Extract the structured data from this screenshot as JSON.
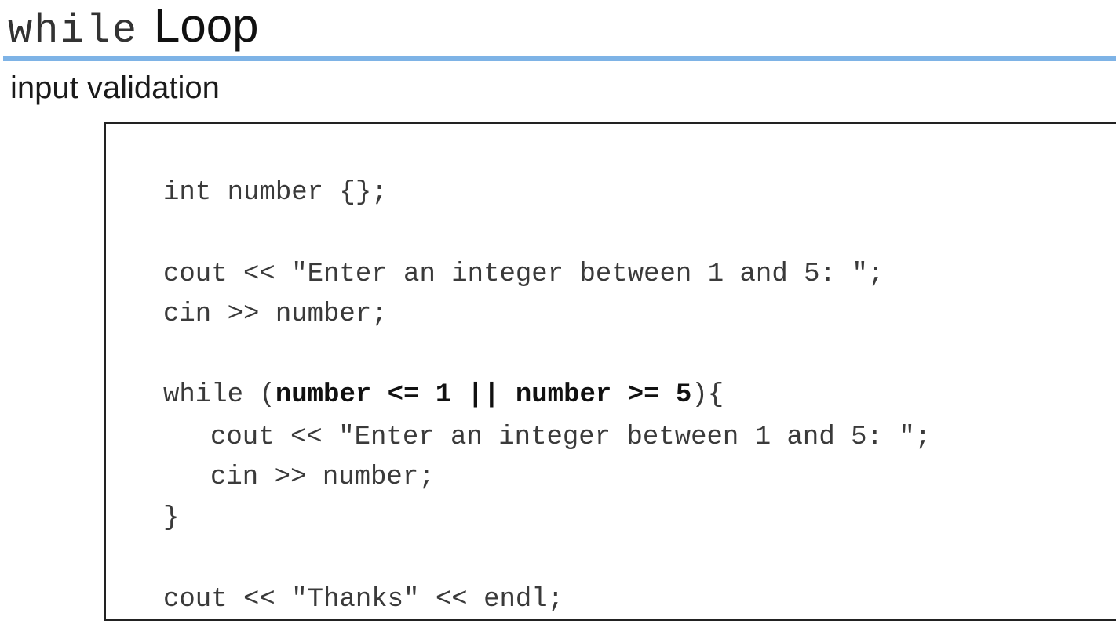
{
  "slide": {
    "title_code": "while",
    "title_word": "Loop",
    "subtitle": "input validation"
  },
  "code": {
    "line1": "int number {};",
    "line2": "cout << \"Enter an integer between 1 and 5: \";",
    "line3": "cin >> number;",
    "line4_prefix": "while (",
    "line4_condition": "number <= 1 || number >= 5",
    "line4_suffix": "){",
    "line5": "cout << \"Enter an integer between 1 and 5: \";",
    "line6": "cin >> number;",
    "line7": "}",
    "line8": "cout << \"Thanks\" << endl;"
  }
}
